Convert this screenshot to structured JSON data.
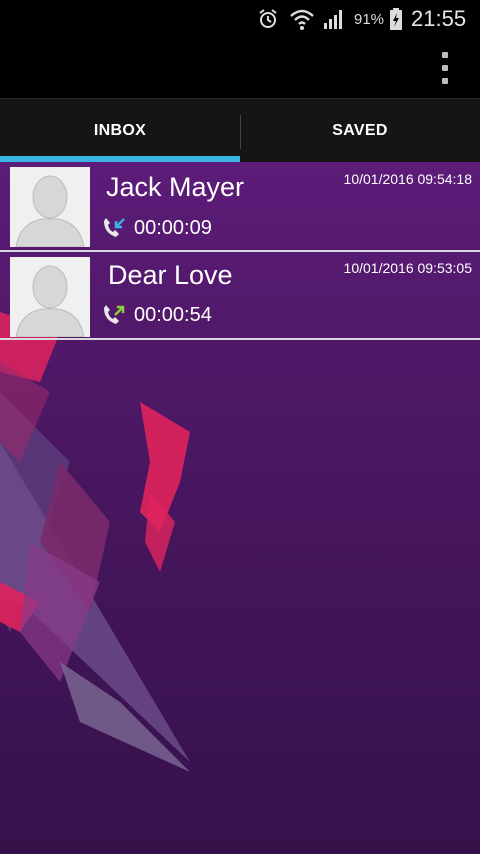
{
  "status_bar": {
    "battery_percent": "91%",
    "time": "21:55"
  },
  "tabs": [
    {
      "label": "INBOX",
      "selected": true
    },
    {
      "label": "SAVED",
      "selected": false
    }
  ],
  "calls": [
    {
      "name": "Jack Mayer",
      "datetime": "10/01/2016 09:54:18",
      "duration": "00:00:09",
      "direction_icon": "outgoing-call-icon"
    },
    {
      "name": "Dear Love",
      "datetime": "10/01/2016 09:53:05",
      "duration": "00:00:54",
      "direction_icon": "incoming-call-icon"
    }
  ],
  "colors": {
    "tab_indicator": "#3bb3e3",
    "background_purple": "#4f1866"
  }
}
